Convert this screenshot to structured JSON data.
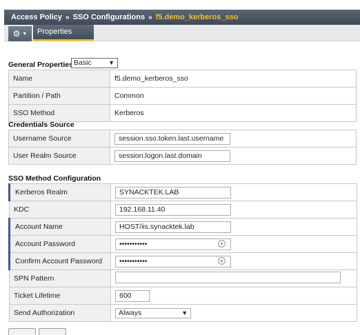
{
  "breadcrumb": {
    "items": [
      "Access Policy",
      "SSO Configurations"
    ],
    "current": "f5.demo_kerberos_sso",
    "separator": "»"
  },
  "toolbar": {
    "gear_icon": "gear-icon",
    "tab_label": "Properties"
  },
  "general": {
    "title": "General Properties:",
    "view_select": "Basic",
    "rows": [
      {
        "label": "Name",
        "value": "f5.demo_kerberos_sso"
      },
      {
        "label": "Partition / Path",
        "value": "Common"
      },
      {
        "label": "SSO Method",
        "value": "Kerberos"
      }
    ]
  },
  "credentials": {
    "title": "Credentials Source",
    "rows": [
      {
        "label": "Username Source",
        "value": "session.sso.token.last.username"
      },
      {
        "label": "User Realm Source",
        "value": "session.logon.last.domain"
      }
    ]
  },
  "sso_method": {
    "title": "SSO Method Configuration",
    "kerberos_realm": {
      "label": "Kerberos Realm",
      "value": "SYNACKTEK.LAB"
    },
    "kdc": {
      "label": "KDC",
      "value": "192.168.11.40"
    },
    "account_name": {
      "label": "Account Name",
      "value": "HOST/iis.synacktek.lab"
    },
    "account_password": {
      "label": "Account Password",
      "value": "•••••••••••"
    },
    "confirm_password": {
      "label": "Confirm Account Password",
      "value": "•••••••••••"
    },
    "spn_pattern": {
      "label": "SPN Pattern",
      "value": ""
    },
    "ticket_lifetime": {
      "label": "Ticket Lifetime",
      "value": "600"
    },
    "send_authorization": {
      "label": "Send Authorization",
      "value": "Always"
    }
  },
  "colors": {
    "accent": "#f2c12e",
    "header_bg": "#4a5563",
    "required_marker": "#3f5a8c"
  }
}
